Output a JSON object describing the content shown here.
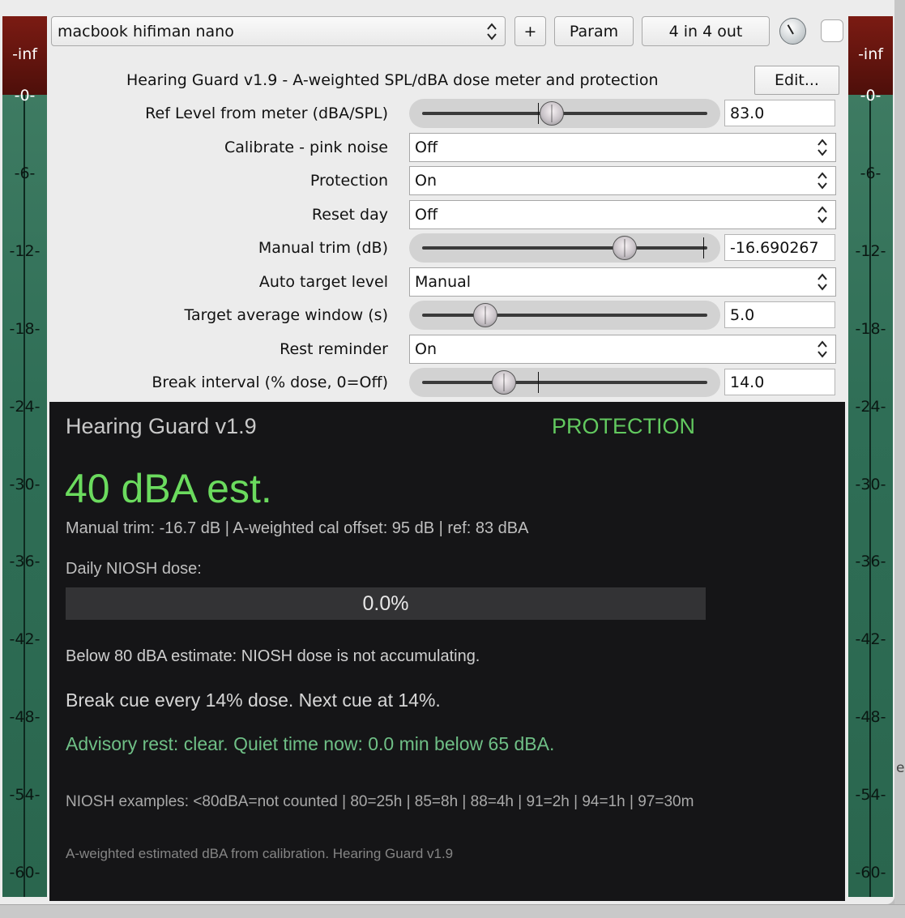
{
  "toolbar": {
    "device": "macbook hifiman nano",
    "add_label": "+",
    "param_label": "Param",
    "io_label": "4 in 4 out"
  },
  "meters": {
    "peak_label": "-inf",
    "ticks": [
      "-0-",
      "-6-",
      "-12-",
      "-18-",
      "-24-",
      "-30-",
      "-36-",
      "-42-",
      "-48-",
      "-54-",
      "-60-"
    ]
  },
  "plugin": {
    "title": "Hearing Guard v1.9 - A-weighted SPL/dBA dose meter and protection",
    "edit_label": "Edit..."
  },
  "params": [
    {
      "label": "Ref Level from meter (dBA/SPL)",
      "type": "slider",
      "value": "83.0",
      "position": 0.455,
      "default_position": 0.405
    },
    {
      "label": "Calibrate - pink noise",
      "type": "select",
      "value": "Off"
    },
    {
      "label": "Protection",
      "type": "select",
      "value": "On"
    },
    {
      "label": "Reset day",
      "type": "select",
      "value": "Off"
    },
    {
      "label": "Manual trim (dB)",
      "type": "slider",
      "value": "-16.690267",
      "position": 0.71,
      "default_position": 0.985
    },
    {
      "label": "Auto target level",
      "type": "select",
      "value": "Manual"
    },
    {
      "label": "Target average window (s)",
      "type": "slider",
      "value": "5.0",
      "position": 0.222,
      "default_position": 0.222
    },
    {
      "label": "Rest reminder",
      "type": "select",
      "value": "On"
    },
    {
      "label": "Break interval (% dose, 0=Off)",
      "type": "slider",
      "value": "14.0",
      "position": 0.288,
      "default_position": 0.405
    }
  ],
  "display": {
    "title": "Hearing Guard v1.9",
    "status": "PROTECTION",
    "dba": "40 dBA est.",
    "info": "Manual trim: -16.7 dB | A-weighted cal offset: 95 dB | ref: 83 dBA",
    "dose_label": "Daily NIOSH dose:",
    "dose_value": "0.0%",
    "dose_fraction": 0.0,
    "below_text": "Below 80 dBA estimate: NIOSH dose is not accumulating.",
    "break_text": "Break cue every 14% dose. Next cue at 14%.",
    "advisory_text": "Advisory rest: clear. Quiet time now: 0.0 min below 65 dBA.",
    "niosh_text": "NIOSH examples: <80dBA=not counted | 80=25h | 85=8h | 88=4h | 91=2h | 94=1h | 97=30m",
    "footer_text": "A-weighted estimated dBA from calibration. Hearing Guard v1.9"
  },
  "colors": {
    "status_green": "#62c95f",
    "dba_green": "#6bdb5e",
    "advisory_green": "#6fbf86",
    "meter_peak": "#6a1710",
    "meter_body": "#336f58"
  }
}
